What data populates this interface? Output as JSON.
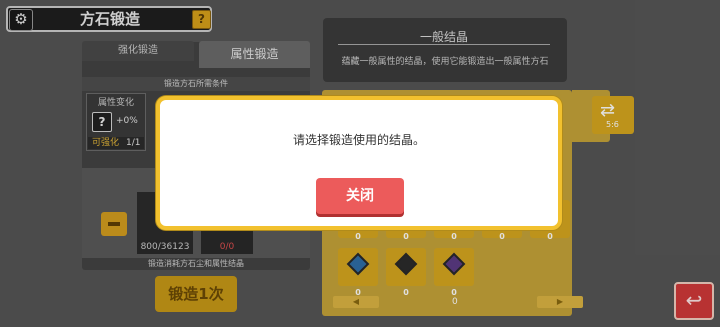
{
  "header": {
    "title": "方石锻造",
    "gear_icon": "gear-icon",
    "help_icon": "help-icon",
    "help_glyph": "?"
  },
  "forge_panel": {
    "tabs": [
      "强化锻造",
      "属性锻造"
    ],
    "requirements_title": "锻造方石所需条件",
    "attribute": {
      "label": "属性变化",
      "glyph": "?",
      "percent": "+0%",
      "strength_label": "可强化",
      "strength_count": "1/1"
    },
    "stone_count": "800/36123",
    "crystal_count": "0/0",
    "cost_label": "锻造消耗方石尘和属性结晶",
    "forge_button": "锻造1次"
  },
  "info": {
    "title": "一般结晶",
    "description": "蕴藏一般属性的结晶，使用它能锻造出一般属性方石"
  },
  "crystal_grid": {
    "counts": [
      "0",
      "0",
      "0",
      "0",
      "0",
      "0",
      "0",
      "0"
    ],
    "switch_label": "5:6",
    "page": "0",
    "prev_glyph": "◀",
    "next_glyph": "▶"
  },
  "modal": {
    "message": "请选择锻造使用的结晶。",
    "close_button": "关闭"
  },
  "return_icon": "return-icon",
  "return_glyph": "↩",
  "colors": {
    "accent_gold": "#d8a81f",
    "modal_border": "#f2c12e",
    "close_red": "#ec5b5b"
  }
}
